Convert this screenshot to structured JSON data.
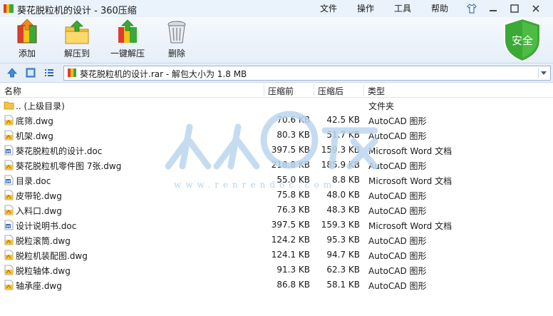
{
  "window": {
    "title": "葵花脱粒机的设计 - 360压缩"
  },
  "menu": {
    "items": [
      "文件",
      "操作",
      "工具",
      "帮助"
    ]
  },
  "toolbar": {
    "add": "添加",
    "extract_to": "解压到",
    "one_click_extract": "一键解压",
    "delete": "删除"
  },
  "security_badge": {
    "label": "安全",
    "color": "#3aa935"
  },
  "path": {
    "text": "葵花脱粒机的设计.rar - 解包大小为 1.8 MB"
  },
  "columns": {
    "name": "名称",
    "packed_before": "压缩前",
    "packed_after": "压缩后",
    "type": "类型"
  },
  "files": [
    {
      "name": ".. (上级目录)",
      "before": "",
      "after": "",
      "type": "文件夹",
      "icon": "folder-icon"
    },
    {
      "name": "底筛.dwg",
      "before": "70.6 KB",
      "after": "42.5 KB",
      "type": "AutoCAD 图形",
      "icon": "dwg-file-icon"
    },
    {
      "name": "机架.dwg",
      "before": "80.3 KB",
      "after": "51.7 KB",
      "type": "AutoCAD 图形",
      "icon": "dwg-file-icon"
    },
    {
      "name": "葵花脱粒机的设计.doc",
      "before": "397.5 KB",
      "after": "159.3 KB",
      "type": "Microsoft Word 文档",
      "icon": "doc-file-icon"
    },
    {
      "name": "葵花脱粒机零件图 7张.dwg",
      "before": "218.8 KB",
      "after": "185.9 KB",
      "type": "AutoCAD 图形",
      "icon": "dwg-file-icon"
    },
    {
      "name": "目录.doc",
      "before": "55.0 KB",
      "after": "8.8 KB",
      "type": "Microsoft Word 文档",
      "icon": "doc-file-icon"
    },
    {
      "name": "皮带轮.dwg",
      "before": "75.8 KB",
      "after": "48.0 KB",
      "type": "AutoCAD 图形",
      "icon": "dwg-file-icon"
    },
    {
      "name": "入料口.dwg",
      "before": "76.3 KB",
      "after": "48.3 KB",
      "type": "AutoCAD 图形",
      "icon": "dwg-file-icon"
    },
    {
      "name": "设计说明书.doc",
      "before": "397.5 KB",
      "after": "159.3 KB",
      "type": "Microsoft Word 文档",
      "icon": "doc-file-icon"
    },
    {
      "name": "脱粒滚筒.dwg",
      "before": "124.2 KB",
      "after": "95.3 KB",
      "type": "AutoCAD 图形",
      "icon": "dwg-file-icon"
    },
    {
      "name": "脱粒机装配图.dwg",
      "before": "124.1 KB",
      "after": "94.7 KB",
      "type": "AutoCAD 图形",
      "icon": "dwg-file-icon"
    },
    {
      "name": "脱粒轴体.dwg",
      "before": "91.3 KB",
      "after": "62.3 KB",
      "type": "AutoCAD 图形",
      "icon": "dwg-file-icon"
    },
    {
      "name": "轴承座.dwg",
      "before": "86.8 KB",
      "after": "58.1 KB",
      "type": "AutoCAD 图形",
      "icon": "dwg-file-icon"
    }
  ],
  "watermark": {
    "text": "www.renrendoc.com"
  }
}
